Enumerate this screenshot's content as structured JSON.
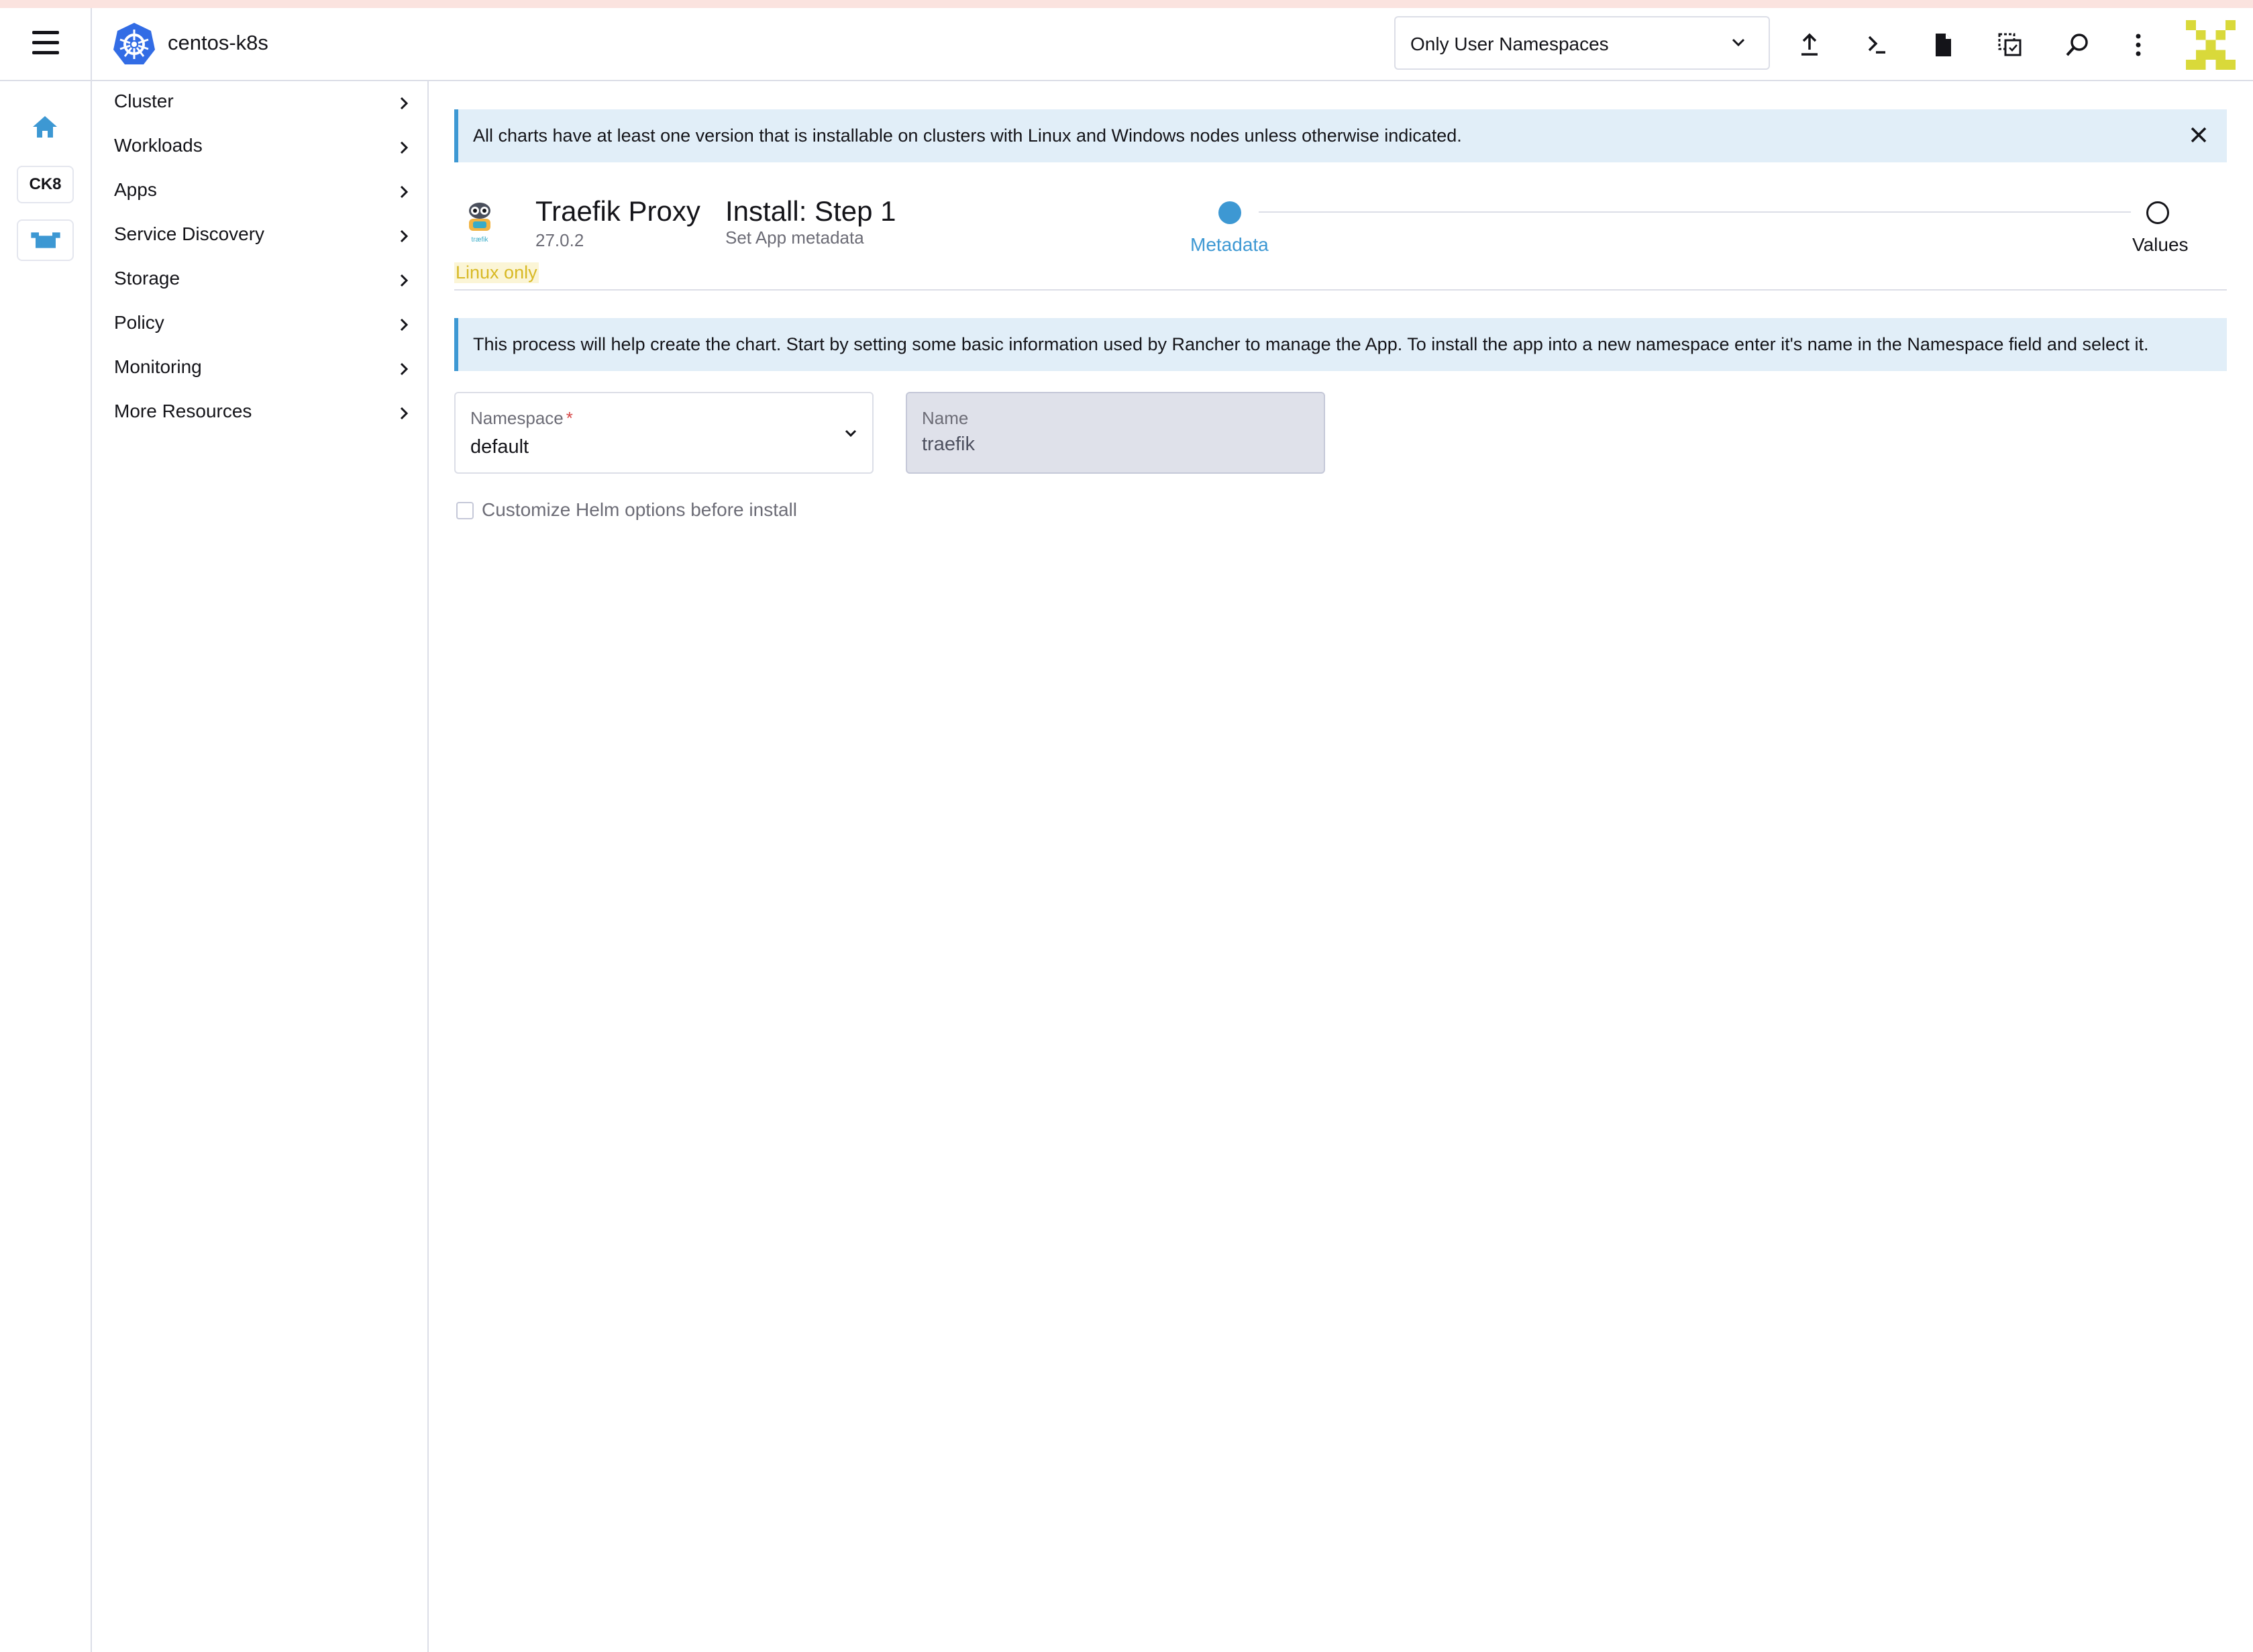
{
  "header": {
    "cluster_name": "centos-k8s",
    "namespace_filter": "Only User Namespaces",
    "icons": [
      "menu-icon",
      "kubernetes-logo-icon",
      "chevron-down-icon",
      "upload-icon",
      "terminal-icon",
      "file-icon",
      "copy-config-icon",
      "search-icon",
      "more-vertical-icon",
      "user-avatar"
    ]
  },
  "rail": {
    "cluster_badge": "CK8",
    "icons": [
      "home-icon",
      "rancher-cow-icon"
    ]
  },
  "sidenav": {
    "items": [
      {
        "label": "Cluster"
      },
      {
        "label": "Workloads"
      },
      {
        "label": "Apps"
      },
      {
        "label": "Service Discovery"
      },
      {
        "label": "Storage"
      },
      {
        "label": "Policy"
      },
      {
        "label": "Monitoring"
      },
      {
        "label": "More Resources"
      }
    ]
  },
  "main": {
    "os_banner": "All charts have at least one version that is installable on clusters with Linux and Windows nodes unless otherwise indicated.",
    "chart": {
      "name": "Traefik Proxy",
      "version": "27.0.2",
      "os_badge": "Linux only"
    },
    "step": {
      "title": "Install: Step 1",
      "subtitle": "Set App metadata"
    },
    "stepper": [
      {
        "label": "Metadata",
        "active": true
      },
      {
        "label": "Values",
        "active": false
      }
    ],
    "info_banner": "This process will help create the chart. Start by setting some basic information used by Rancher to manage the App. To install the app into a new namespace enter it's name in the Namespace field and select it.",
    "form": {
      "namespace_label": "Namespace",
      "namespace_required": "*",
      "namespace_value": "default",
      "name_label": "Name",
      "name_value": "traefik",
      "customize_label": "Customize Helm options before install"
    }
  },
  "colors": {
    "accent": "#3d98d3",
    "banner_bg": "#e1eef8",
    "linux_badge": "#d8b924",
    "border": "#dcdee7"
  }
}
